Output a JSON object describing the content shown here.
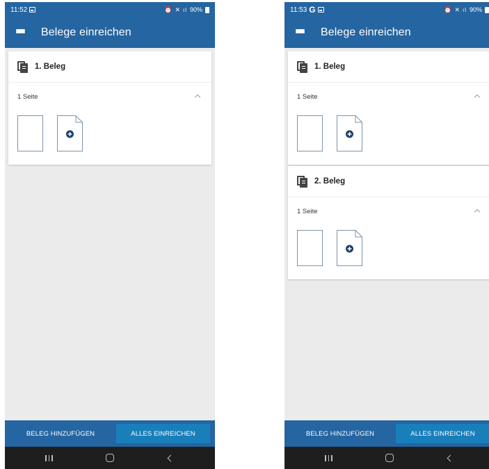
{
  "screens": [
    {
      "status": {
        "time": "11:52",
        "battery": "90%",
        "show_g": false
      },
      "app_title": "Belege einreichen",
      "cards": [
        {
          "title": "1. Beleg",
          "pages": "1 Seite"
        }
      ],
      "buttons": {
        "add": "BELEG HINZUFÜGEN",
        "submit": "ALLES EINREICHEN"
      }
    },
    {
      "status": {
        "time": "11:53",
        "battery": "90%",
        "g": "G"
      },
      "app_title": "Belege einreichen",
      "cards": [
        {
          "title": "1. Beleg",
          "pages": "1 Seite"
        },
        {
          "title": "2. Beleg",
          "pages": "1 Seite"
        }
      ],
      "buttons": {
        "add": "BELEG HINZUFÜGEN",
        "submit": "ALLES EINREICHEN"
      }
    }
  ],
  "colors": {
    "primary": "#2565a1",
    "submit_button": "#187fbb",
    "background": "#ebebeb",
    "navbar": "#1e1e1e",
    "accent_icon": "#1b3f66"
  },
  "icons": [
    "menu-icon",
    "document-icon",
    "chevron-up-icon",
    "add-page-icon",
    "recents-icon",
    "home-icon",
    "back-icon"
  ]
}
